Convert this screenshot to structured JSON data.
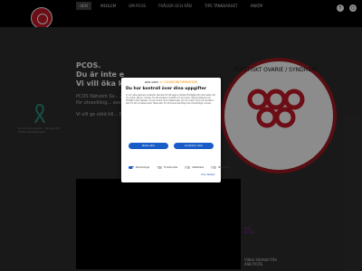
{
  "nav": {
    "items": [
      "HEM",
      "MEDLEM",
      "OM PCOS",
      "FRÅGOR OCH RÅD",
      "TIPS TÄNKBARHET",
      "ANKÖP"
    ],
    "active_index": 0
  },
  "social": [
    "f",
    "○"
  ],
  "hero": {
    "title": "PCOS.",
    "subtitle1": "Du är inte e",
    "subtitle2": "Vi vill öka k",
    "para": "PCOS Nätverk Sv... 2021 i samband... ansvarig för utveckling... avvecklingen av...",
    "para2": "Vi vill ge stöd till... PCOS i Sverige.",
    "ribbon_caption": "Du är inte ensam... kämpar för PCOS-medvetenhet"
  },
  "brand_circle_text": "YCYSTISKT OVARIE / SYNDROM",
  "video_caption": [
    "Video hämtat från",
    "ASK PCOS"
  ],
  "askpcos_label": "Ask PCOS",
  "modal": {
    "brand_left": "one.com",
    "brand_sep": "✕",
    "brand_right": "COOKIEINFORMATION",
    "title": "Du har kontroll över dina uppgifter",
    "body": "Vi och våra partners använder tekniker för att lagra och/eller få tillgång till information på din enhet, såsom cookies, för att anpassa innehåll och annonser, mäta prestanda och förbättra våra tjänster. Du kan ändra dina inställningar när som helst. Tryck på 'Godkänn alla' för att acceptera eller 'Neka alla' för att avvisa samtliga icke nödvändiga cookies.",
    "btn_reject": "Neka alla",
    "btn_accept": "Godkänn alla",
    "checks": [
      {
        "label": "Nödvändiga",
        "on": true
      },
      {
        "label": "Funktionella",
        "on": false
      },
      {
        "label": "Statistiska",
        "on": false
      },
      {
        "label": "Marketing",
        "on": false
      }
    ],
    "details_link": "Visa detaljer"
  }
}
